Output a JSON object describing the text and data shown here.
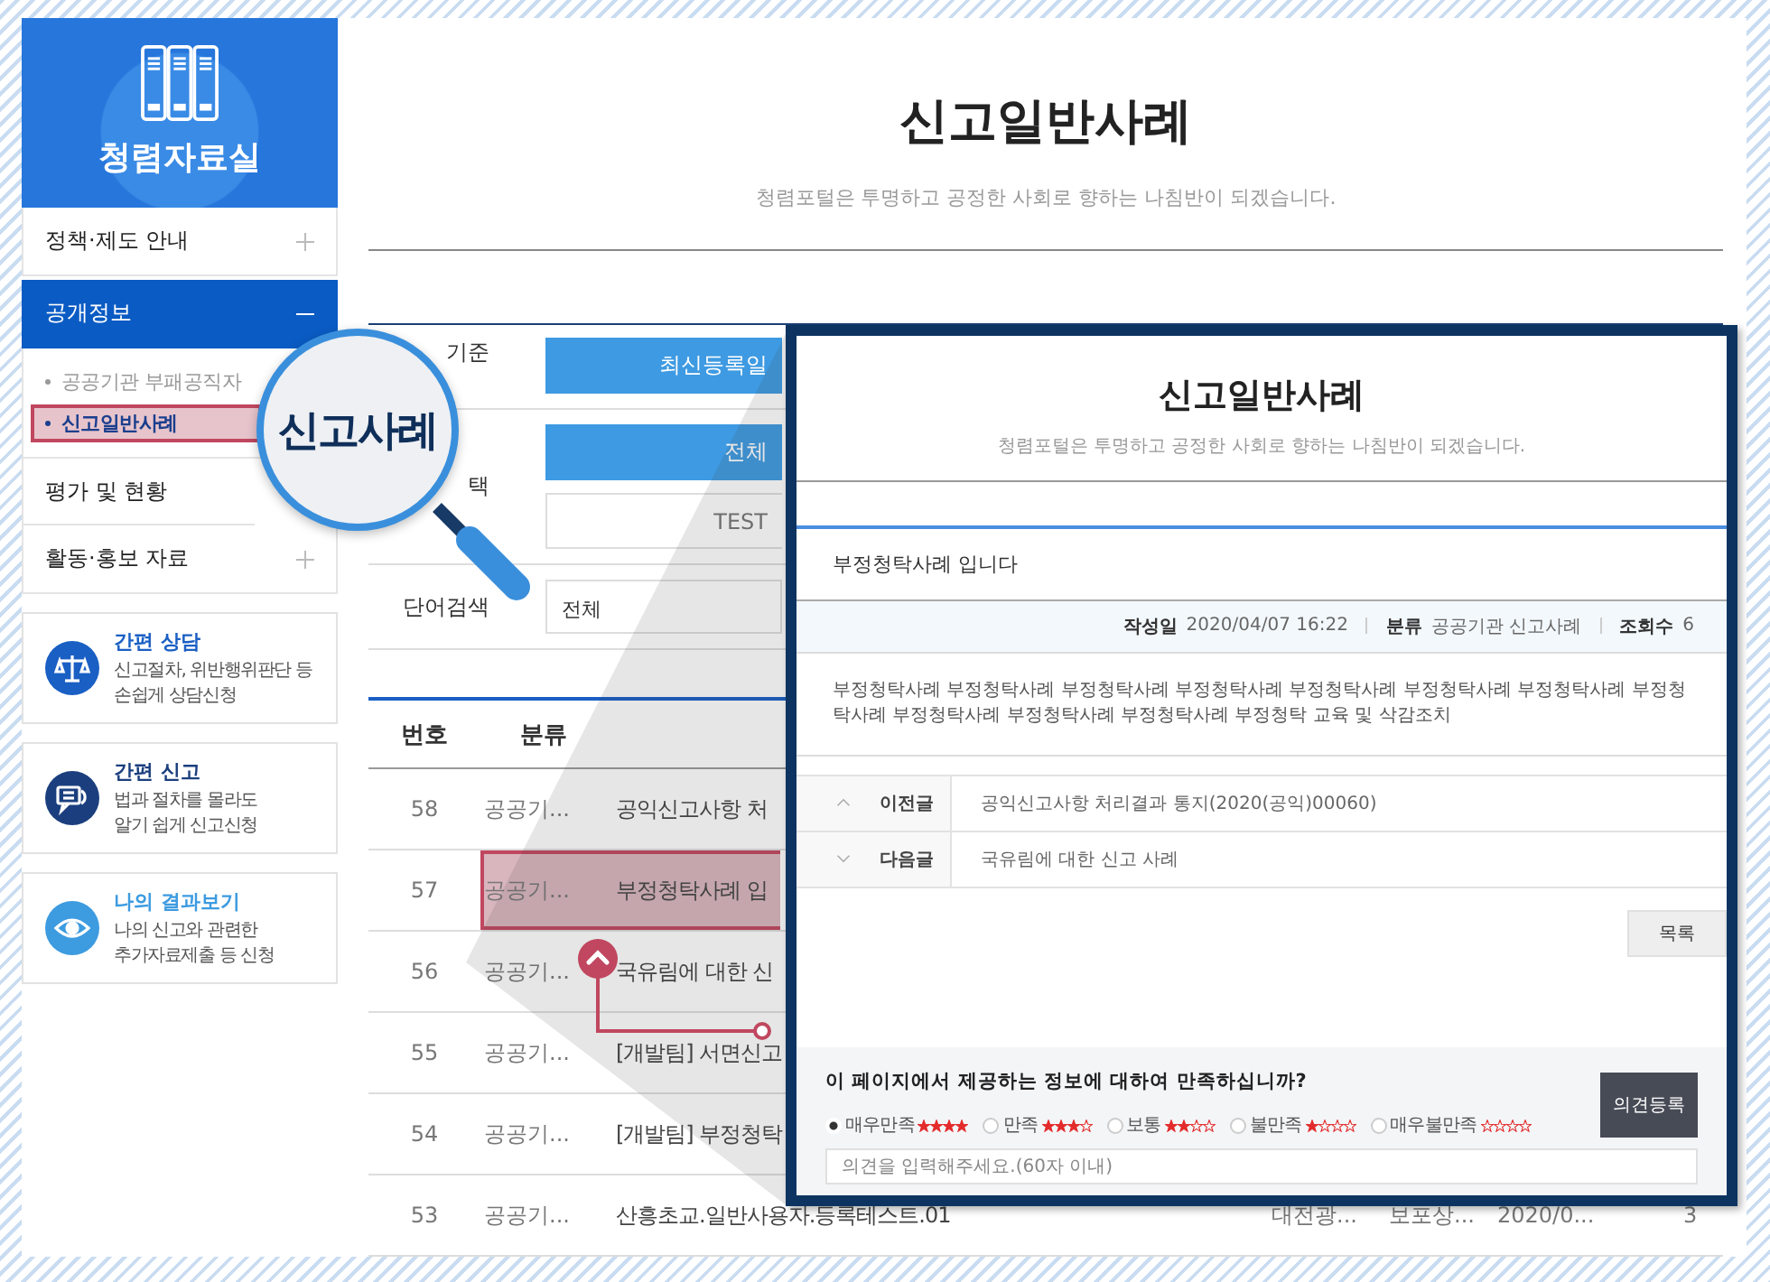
{
  "sidebar": {
    "title": "청렴자료실",
    "menu": [
      {
        "label": "정책·제도 안내",
        "toggle": true,
        "expanded": false
      },
      {
        "label": "공개정보",
        "toggle": true,
        "expanded": true,
        "children": [
          {
            "label": "공공기관 부패공직자",
            "selected": false
          },
          {
            "label": "신고일반사례",
            "selected": true
          }
        ]
      },
      {
        "label": "평가 및 현황",
        "toggle": false,
        "expanded": false
      },
      {
        "label": "활동·홍보 자료",
        "toggle": true,
        "expanded": false
      }
    ],
    "cards": [
      {
        "kind": "scale",
        "title": "간편 상담",
        "color": "#1a5fc4",
        "lines": [
          "신고절차, 위반행위판단 등",
          "손쉽게 상담신청"
        ]
      },
      {
        "kind": "chat",
        "title": "간편 신고",
        "color": "#1b3f7e",
        "lines": [
          "법과 절차를 몰라도",
          "알기 쉽게 신고신청"
        ]
      },
      {
        "kind": "eye",
        "title": "나의 결과보기",
        "color": "#3d9be0",
        "lines": [
          "나의 신고와 관련한",
          "추가자료제출 등 신청"
        ]
      }
    ]
  },
  "main": {
    "title": "신고일반사례",
    "subtitle": "청렴포털은 투명하고 공정한 사회로 향하는 나침반이 되겠습니다.",
    "filters": [
      {
        "label": "기준",
        "kind": "buttons",
        "options": [
          {
            "label": "최신등록일",
            "selected": true
          }
        ]
      },
      {
        "label": "택",
        "kind": "buttons",
        "options": [
          {
            "label": "전체",
            "selected": true
          },
          {
            "label": "TEST",
            "selected": false
          }
        ]
      },
      {
        "label": "단어검색",
        "kind": "select",
        "value": "전체"
      }
    ],
    "table": {
      "columns": [
        "번호",
        "분류"
      ],
      "rows": [
        {
          "cells": [
            "58",
            "공공기...",
            "공익신고사항 처"
          ],
          "highlighted": false
        },
        {
          "cells": [
            "57",
            "공공기...",
            "부정청탁사례 입"
          ],
          "highlighted": true
        },
        {
          "cells": [
            "56",
            "공공기...",
            "국유림에 대한 신"
          ],
          "highlighted": false
        },
        {
          "cells": [
            "55",
            "공공기...",
            "[개발팀] 서면신고"
          ],
          "highlighted": false
        },
        {
          "cells": [
            "54",
            "공공기...",
            "[개발팀] 부정청탁"
          ],
          "highlighted": false
        },
        {
          "cells": [
            "53",
            "공공기...",
            "산흥초교.일반사용자.등록테스트.01",
            "대전광...",
            "보포상...",
            "2020/0...",
            "3"
          ],
          "highlighted": false
        }
      ]
    }
  },
  "magnifier": {
    "label": "신고사례"
  },
  "detail": {
    "title": "신고일반사례",
    "subtitle": "청렴포털은 투명하고 공정한 사회로 향하는 나침반이 되겠습니다.",
    "post_title": "부정청탁사례 입니다",
    "meta": [
      {
        "label": "작성일",
        "value": "2020/04/07 16:22"
      },
      {
        "label": "분류",
        "value": "공공기관 신고사례"
      },
      {
        "label": "조회수",
        "value": "6"
      }
    ],
    "body": "부정청탁사례 부정청탁사례 부정청탁사례 부정청탁사례 부정청탁사례 부정청탁사례 부정청탁사례 부정청탁사례 부정청탁사례 부정청탁사례 부정청탁사례 부정청탁 교육 및 삭감조치",
    "nav": [
      {
        "kind": "prev",
        "label": "이전글",
        "text": "공익신고사항 처리결과 통지(2020(공익)00060)"
      },
      {
        "kind": "next",
        "label": "다음글",
        "text": "국유림에 대한 신고 사례"
      }
    ],
    "list_button": "목록",
    "survey": {
      "question": "이 페이지에서 제공하는 정보에 대하여 만족하십니까?",
      "options": [
        {
          "label": "매우만족",
          "stars": 4,
          "selected": true
        },
        {
          "label": "만족",
          "stars": 3,
          "selected": false
        },
        {
          "label": "보통",
          "stars": 2,
          "selected": false
        },
        {
          "label": "불만족",
          "stars": 1,
          "selected": false
        },
        {
          "label": "매우불만족",
          "stars": 0,
          "selected": false
        }
      ],
      "submit": "의견등록",
      "placeholder": "의견을 입력해주세요.(60자 이내)"
    }
  }
}
